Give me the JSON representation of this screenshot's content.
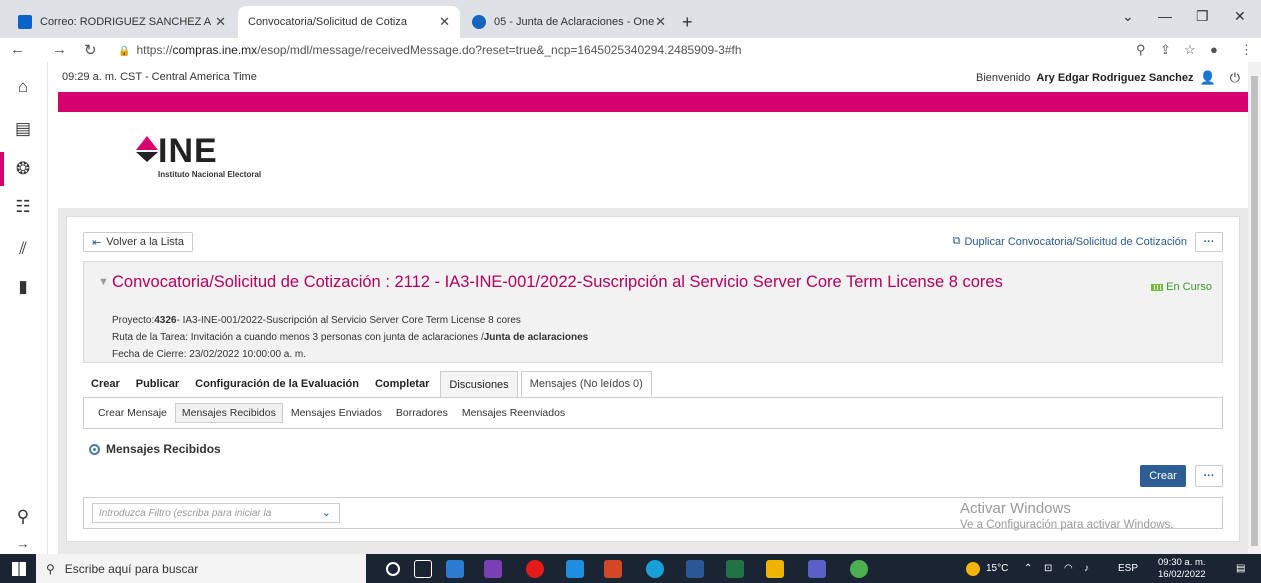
{
  "browser": {
    "tabs": [
      {
        "label": "Correo: RODRIGUEZ SANCHEZ A",
        "active": false
      },
      {
        "label": "Convocatoria/Solicitud de Cotiza",
        "active": true
      },
      {
        "label": "05 - Junta de Aclaraciones - One",
        "active": false
      }
    ],
    "url_prefix": "https://",
    "url_domain": "compras.ine.mx",
    "url_path": "/esop/mdl/message/receivedMessage.do?reset=true&_ncp=1645025340294.2485909-3#fh"
  },
  "header": {
    "time": "09:29 a. m. CST - Central America Time",
    "welcome_label": "Bienvenido",
    "user_name": "Ary Edgar Rodriguez Sanchez"
  },
  "logo": {
    "text": "INE",
    "subtitle": "Instituto Nacional Electoral"
  },
  "actions": {
    "back": "Volver a la Lista",
    "duplicate": "Duplicar Convocatoria/Solicitud de Cotización",
    "more": "···",
    "more2": "···"
  },
  "project": {
    "title": "Convocatoria/Solicitud de Cotización : 2112 - IA3-INE-001/2022-Suscripción al Servicio Server Core Term License 8 cores",
    "status": "En Curso",
    "project_label": "Proyecto:",
    "project_id": "4326",
    "project_desc": "- IA3-INE-001/2022-Suscripción al Servicio Server Core Term License 8 cores",
    "route_label": "Ruta de la Tarea: Invitación a cuando menos 3 personas con junta de aclaraciones /",
    "route_step": "Junta de aclaraciones",
    "close_date": "Fecha de Cierre: 23/02/2022 10:00:00 a. m."
  },
  "tabs": [
    "Crear",
    "Publicar",
    "Configuración de la Evaluación",
    "Completar",
    "Discusiones",
    "Mensajes (No leídos 0)"
  ],
  "subtabs": [
    "Crear Mensaje",
    "Mensajes Recibidos",
    "Mensajes Enviados",
    "Borradores",
    "Mensajes Reenviados"
  ],
  "section_title": "Mensajes Recibidos",
  "create_button": "Crear",
  "filter_placeholder": "Introduzca Filtro (escriba para iniciar la",
  "watermark": {
    "line1": "Activar Windows",
    "line2": "Ve a Configuración para activar Windows."
  },
  "taskbar": {
    "search": "Escribe aquí para buscar",
    "weather": "15°C",
    "lang": "ESP",
    "time": "09:30 a. m.",
    "date": "16/02/2022"
  },
  "colors": {
    "accent": "#d6006f",
    "title": "#b5005f",
    "primary_button": "#2d5e93",
    "status": "#3a9a2a"
  }
}
